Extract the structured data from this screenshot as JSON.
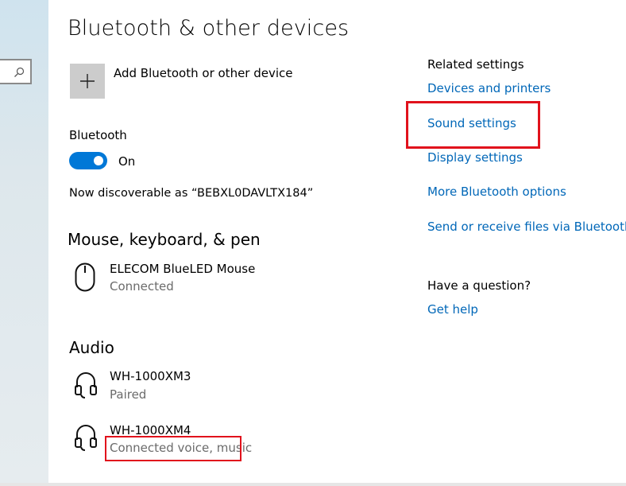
{
  "page": {
    "title": "Bluetooth & other devices",
    "add_device_label": "Add Bluetooth or other device"
  },
  "bluetooth": {
    "label": "Bluetooth",
    "state": "On",
    "discoverable": "Now discoverable as “BEBXL0DAVLTX184”"
  },
  "sections": {
    "mouse_keyboard_pen": {
      "heading": "Mouse, keyboard, & pen",
      "devices": [
        {
          "name": "ELECOM BlueLED Mouse",
          "status": "Connected",
          "icon": "mouse-icon"
        }
      ]
    },
    "audio": {
      "heading": "Audio",
      "devices": [
        {
          "name": "WH-1000XM3",
          "status": "Paired",
          "icon": "headphones-icon"
        },
        {
          "name": "WH-1000XM4",
          "status": "Connected voice, music",
          "icon": "headphones-icon"
        }
      ]
    }
  },
  "related": {
    "heading": "Related settings",
    "links": [
      "Devices and printers",
      "Sound settings",
      "Display settings",
      "More Bluetooth options",
      "Send or receive files via Bluetooth"
    ]
  },
  "help": {
    "heading": "Have a question?",
    "link": "Get help"
  },
  "colors": {
    "accent": "#0078d7",
    "link": "#0067b8",
    "highlight": "#e1121c"
  }
}
